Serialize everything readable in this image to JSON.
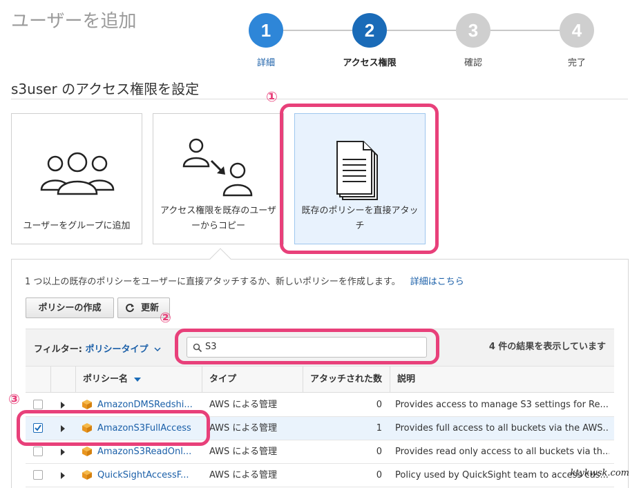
{
  "page": {
    "title": "ユーザーを追加"
  },
  "steps": [
    {
      "number": "1",
      "label": "詳細",
      "state": "done"
    },
    {
      "number": "2",
      "label": "アクセス権限",
      "state": "active"
    },
    {
      "number": "3",
      "label": "確認",
      "state": "todo"
    },
    {
      "number": "4",
      "label": "完了",
      "state": "todo"
    }
  ],
  "section": {
    "title": "s3user のアクセス権限を設定"
  },
  "options": [
    {
      "label": "ユーザーをグループに追加",
      "icon": "user-group-icon"
    },
    {
      "label": "アクセス権限を既存のユーザーからコピー",
      "icon": "copy-user-icon"
    },
    {
      "label": "既存のポリシーを直接アタッチ",
      "icon": "document-stack-icon",
      "selected": true
    }
  ],
  "markers": {
    "one": "①",
    "two": "②",
    "three": "③"
  },
  "panel": {
    "description": "1 つ以上の既存のポリシーをユーザーに直接アタッチするか、新しいポリシーを作成します。",
    "learn_more": "詳細はこちら",
    "create_policy_label": "ポリシーの作成",
    "refresh_label": "更新"
  },
  "filter": {
    "label": "フィルター:",
    "value": "ポリシータイプ",
    "search_value": "S3",
    "result_count": "4 件の結果を表示しています"
  },
  "table": {
    "columns": {
      "name": "ポリシー名",
      "type": "タイプ",
      "attached": "アタッチされた数",
      "description": "説明"
    },
    "rows": [
      {
        "name": "AmazonDMSRedshi...",
        "type": "AWS による管理",
        "attached": "0",
        "description": "Provides access to manage S3 settings for Re...",
        "checked": false
      },
      {
        "name": "AmazonS3FullAccess",
        "type": "AWS による管理",
        "attached": "1",
        "description": "Provides full access to all buckets via the AWS...",
        "checked": true
      },
      {
        "name": "AmazonS3ReadOnl...",
        "type": "AWS による管理",
        "attached": "0",
        "description": "Provides read only access to all buckets via th...",
        "checked": false
      },
      {
        "name": "QuickSightAccessF...",
        "type": "AWS による管理",
        "attached": "0",
        "description": "Policy used by QuickSight team to access cus...",
        "checked": false
      }
    ]
  },
  "watermark": "ktykwsk.com",
  "colors": {
    "accent": "#1a6bb8",
    "highlight": "#e8407a",
    "link": "#1a5fa8"
  }
}
